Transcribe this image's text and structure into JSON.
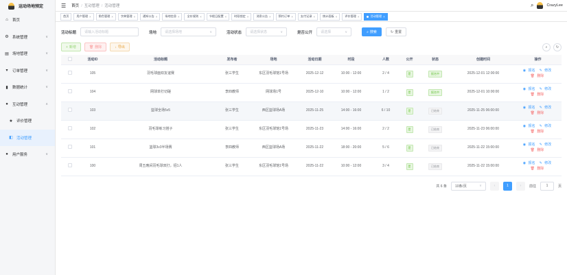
{
  "app": {
    "title": "运动场地预定",
    "brand_color": "#409eff"
  },
  "sidebar": {
    "items": [
      {
        "label": "首页",
        "icon": "home-icon"
      },
      {
        "label": "系统管理",
        "icon": "gear-icon"
      },
      {
        "label": "场地管理",
        "icon": "venue-icon"
      },
      {
        "label": "订单管理",
        "icon": "cart-icon"
      },
      {
        "label": "数据统计",
        "icon": "chart-icon"
      },
      {
        "label": "互动管理",
        "icon": "people-icon"
      },
      {
        "label": "评价管理",
        "icon": "star-icon"
      },
      {
        "label": "活动管理",
        "icon": "activity-icon"
      },
      {
        "label": "用户服务",
        "icon": "user-icon"
      }
    ]
  },
  "header": {
    "breadcrumb": [
      "首页",
      "互动管理",
      "活动管理"
    ],
    "username": "CrazyLee"
  },
  "tabs": [
    "首页",
    "用户管理",
    "角色管理",
    "字典管理",
    "通知公告",
    "场地信息",
    "全价规则",
    "节假日配置",
    "时段锁定",
    "消息公告",
    "预约订单",
    "支付记录",
    "统计面板",
    "评价管理",
    "活动管理"
  ],
  "filters": {
    "title_label": "活动标题",
    "title_placeholder": "请输入活动标题",
    "venue_label": "场地",
    "venue_placeholder": "请选择场地",
    "status_label": "活动状态",
    "status_placeholder": "请选择状态",
    "public_label": "是否公开",
    "public_placeholder": "请选择",
    "search_label": "搜索",
    "reset_label": "重置"
  },
  "actions": {
    "add": "新增",
    "delete": "删除",
    "export": "导出"
  },
  "table": {
    "columns": [
      "活动ID",
      "活动标题",
      "发布者",
      "场地",
      "活动日期",
      "时段",
      "人数",
      "公开",
      "状态",
      "创建时间",
      "操作"
    ],
    "rows": [
      {
        "id": "105",
        "title": "羽毛球面双友谊赛",
        "publisher": "张三学生",
        "venue": "东区羽毛球馆1号场",
        "date": "2025-12-12",
        "time": "10:00 - 12:00",
        "people": "2 / 4",
        "public": "是",
        "status": "报名中",
        "status_type": "green",
        "created": "2025-12-01 12:00:00"
      },
      {
        "id": "104",
        "title": "网球单打切磋",
        "publisher": "李四教师",
        "venue": "网球场1号",
        "date": "2025-12-10",
        "time": "10:00 - 12:00",
        "people": "1 / 2",
        "public": "是",
        "status": "报名中",
        "status_type": "green",
        "created": "2025-12-01 10:00:00"
      },
      {
        "id": "103",
        "title": "篮球全场5v5",
        "publisher": "张三学生",
        "venue": "西区篮球场A场",
        "date": "2025-11-25",
        "time": "14:00 - 16:00",
        "people": "6 / 10",
        "public": "是",
        "status": "已结束",
        "status_type": "gray",
        "created": "2025-11-25 06:00:00"
      },
      {
        "id": "102",
        "title": "羽毛球练习搭子",
        "publisher": "张三学生",
        "venue": "东区羽毛球馆1号场",
        "date": "2025-11-23",
        "time": "14:00 - 16:00",
        "people": "2 / 2",
        "public": "是",
        "status": "已结束",
        "status_type": "gray",
        "created": "2025-11-23 06:00:00"
      },
      {
        "id": "101",
        "title": "篮球3v3半场赛",
        "publisher": "李四教师",
        "venue": "西区篮球场A场",
        "date": "2025-11-22",
        "time": "18:00 - 20:00",
        "people": "5 / 6",
        "public": "是",
        "status": "已结束",
        "status_type": "gray",
        "created": "2025-11-22 15:00:00"
      },
      {
        "id": "100",
        "title": "周五晚间羽毛球双打，招1人",
        "publisher": "张三学生",
        "venue": "东区羽毛球馆1号场",
        "date": "2025-11-22",
        "time": "10:00 - 12:00",
        "people": "3 / 4",
        "public": "是",
        "status": "已结束",
        "status_type": "gray",
        "created": "2025-11-22 15:00:00"
      }
    ],
    "op_signup": "报名",
    "op_edit": "修改",
    "op_delete": "删除"
  },
  "pagination": {
    "total": "共 6 条",
    "page_size": "10条/页",
    "current": "1",
    "goto_label": "前往",
    "goto_value": "1",
    "page_suffix": "页"
  }
}
